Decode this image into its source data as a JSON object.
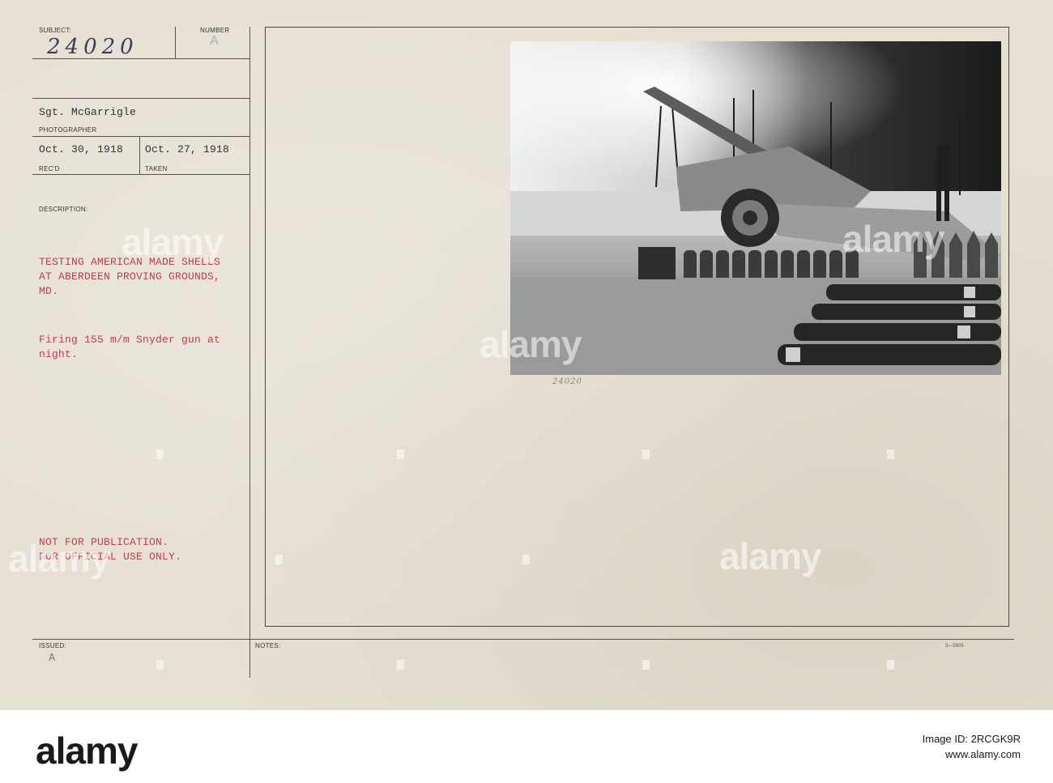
{
  "card": {
    "subject_label": "SUBJECT:",
    "subject_number": "24020",
    "number_label": "NUMBER",
    "number_value": "A",
    "photographer_name": "Sgt. McGarrigle",
    "photographer_label": "PHOTOGRAPHER",
    "received_date": "Oct. 30, 1918",
    "received_label": "REC'D",
    "taken_date": "Oct. 27, 1918",
    "taken_label": "TAKEN",
    "description_label": "DESCRIPTION:",
    "description_lines": [
      "TESTING AMERICAN MADE SHELLS",
      "AT ABERDEEN PROVING GROUNDS,",
      "MD."
    ],
    "caption_lines": [
      "Firing 155 m/m Snyder gun at",
      "night."
    ],
    "restriction_lines": [
      "NOT FOR PUBLICATION.",
      "FOR OFFICIAL USE ONLY."
    ],
    "issued_label": "ISSUED:",
    "notes_label": "NOTES:",
    "form_code": "3—5605",
    "photo_number": "24020",
    "corner_mark": "A"
  },
  "watermark": {
    "brand": "alamy",
    "image_id_label": "Image ID: 2RCGK9R",
    "url": "www.alamy.com"
  },
  "colors": {
    "card": "#e6e0d3",
    "typed_red": "#c63a4c",
    "typed_dark": "#2f2f38",
    "rule": "#5b5247"
  }
}
